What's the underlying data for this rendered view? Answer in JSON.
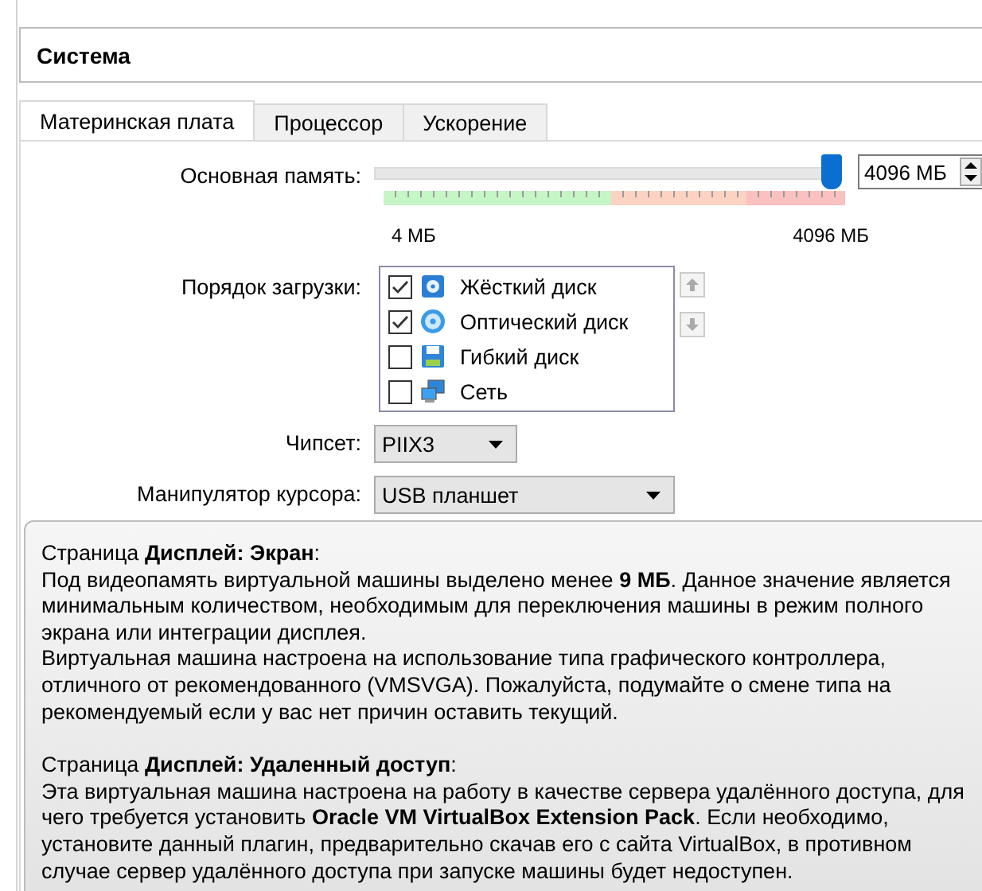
{
  "title": "Система",
  "tabs": [
    {
      "label": "Материнская плата",
      "selected": true
    },
    {
      "label": "Процессор",
      "selected": false
    },
    {
      "label": "Ускорение",
      "selected": false
    }
  ],
  "memory": {
    "label": "Основная память:",
    "level": 1,
    "value": "4096 МБ",
    "min_label": "4 МБ",
    "max_label": "4096 МБ"
  },
  "boot_order": {
    "label": "Порядок загрузки:",
    "items": [
      {
        "name": "Жёсткий диск",
        "checked": true,
        "kind": "hdd"
      },
      {
        "name": "Оптический диск",
        "checked": true,
        "kind": "optical"
      },
      {
        "name": "Гибкий диск",
        "checked": false,
        "kind": "floppy"
      },
      {
        "name": "Сеть",
        "checked": false,
        "kind": "network"
      }
    ]
  },
  "chipset": {
    "label": "Чипсет:",
    "value": "PIIX3"
  },
  "pointing_device": {
    "label": "Манипулятор курсора:",
    "value": "USB планшет"
  },
  "warning_popup": {
    "paragraphs": [
      {
        "kind": "heading",
        "text": "Страница **Дисплей: Экран**:"
      },
      {
        "kind": "body",
        "text": "Под видеопамять виртуальной машины выделено менее **9 МБ**. Данное значение является минимальным количеством, необходимым для переключения машины в режим полного экрана или интеграции дисплея."
      },
      {
        "kind": "body",
        "text": "Виртуальная машина настроена на использование типа графического контроллера, отличного от рекомендованного (VMSVGA). Пожалуйста, подумайте о смене типа на рекомендуемый если у вас нет причин оставить текущий."
      },
      {
        "kind": "heading",
        "text": "Страница **Дисплей: Удаленный доступ**:"
      },
      {
        "kind": "body",
        "text": "Эта виртуальная машина настроена на работу в качестве сервера удалённого доступа, для чего требуется установить **Oracle VM VirtualBox Extension Pack**. Если необходимо, установите данный плагин, предварительно скачав его с сайта VirtualBox, в противном случае сервер удалённого доступа при запуске машины будет недоступен."
      }
    ]
  }
}
